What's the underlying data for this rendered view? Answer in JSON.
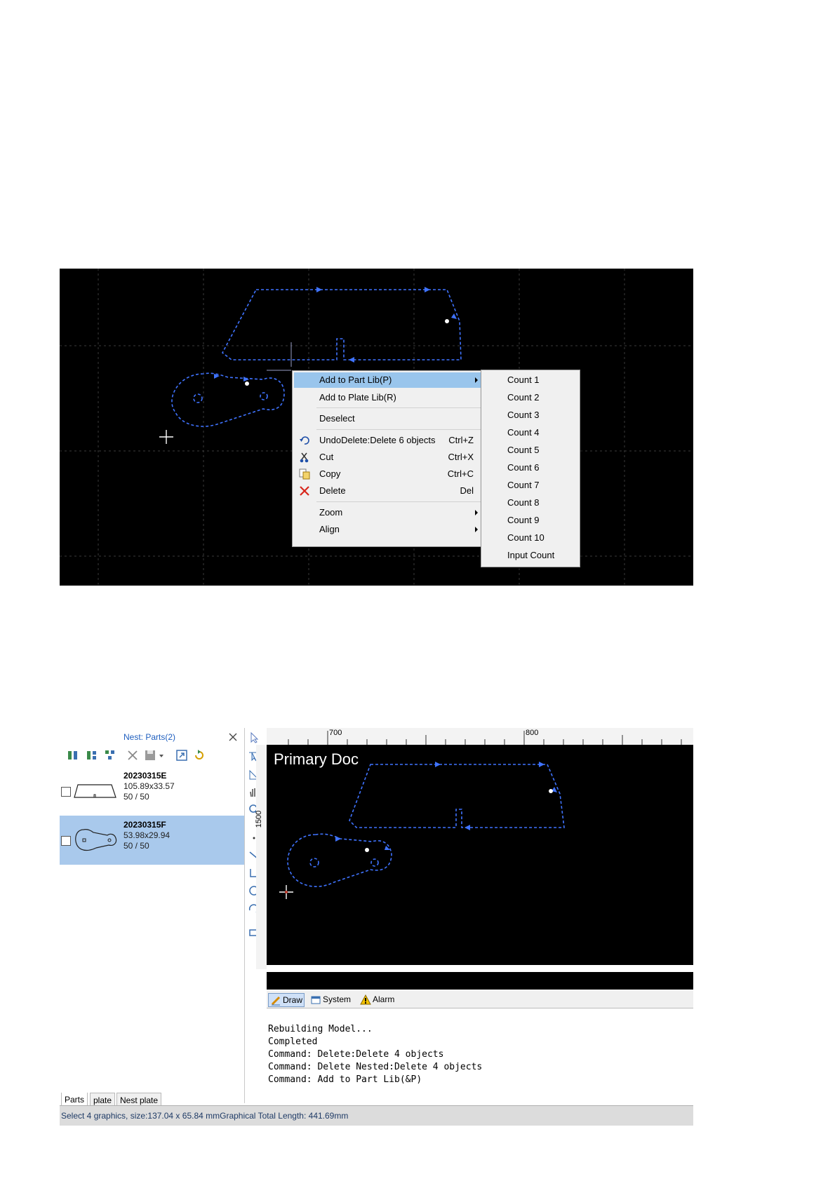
{
  "shot1": {
    "context_menu": {
      "items": [
        {
          "label": "Add to Part Lib(P)",
          "shortcut": "",
          "submenu": true,
          "highlighted": true
        },
        {
          "label": "Add to Plate Lib(R)",
          "shortcut": "",
          "submenu": false
        },
        {
          "label": "Deselect",
          "shortcut": "",
          "submenu": false
        },
        {
          "label": "UndoDelete:Delete 6 objects",
          "shortcut": "Ctrl+Z",
          "icon": "undo-icon"
        },
        {
          "label": "Cut",
          "shortcut": "Ctrl+X",
          "icon": "scissors-icon"
        },
        {
          "label": "Copy",
          "shortcut": "Ctrl+C",
          "icon": "copy-icon"
        },
        {
          "label": "Delete",
          "shortcut": "Del",
          "icon": "delete-x-icon"
        },
        {
          "label": "Zoom",
          "shortcut": "",
          "submenu": true
        },
        {
          "label": "Align",
          "shortcut": "",
          "submenu": true
        }
      ]
    },
    "submenu": {
      "items": [
        "Count 1",
        "Count 2",
        "Count 3",
        "Count 4",
        "Count 5",
        "Count 6",
        "Count 7",
        "Count 8",
        "Count 9",
        "Count 10",
        "Input Count"
      ]
    }
  },
  "shot2": {
    "panel_title": "Nest: Parts(2)",
    "parts": [
      {
        "name": "20230315E",
        "size": "105.89x33.57",
        "count": "50 / 50",
        "selected": false
      },
      {
        "name": "20230315F",
        "size": "53.98x29.94",
        "count": "50 / 50",
        "selected": true
      }
    ],
    "bottom_tabs": [
      "Parts",
      "plate",
      "Nest plate"
    ],
    "ruler": {
      "top_labels": [
        "700",
        "800"
      ],
      "left_label": "1500"
    },
    "doc_title": "Primary Doc",
    "output_tabs": [
      "Draw",
      "System",
      "Alarm"
    ],
    "command_lines": [
      "Rebuilding Model...",
      "Completed",
      "Command: Delete:Delete 4 objects",
      "Command: Delete Nested:Delete 4 objects",
      "Command: Add to Part Lib(&P)"
    ],
    "status": "Select 4 graphics, size:137.04 x 65.84 mmGraphical Total Length: 441.69mm",
    "colors": {
      "path": "#3f73ff",
      "selected_row": "#a9c9ec",
      "title_blue": "#1f5fbf"
    }
  }
}
